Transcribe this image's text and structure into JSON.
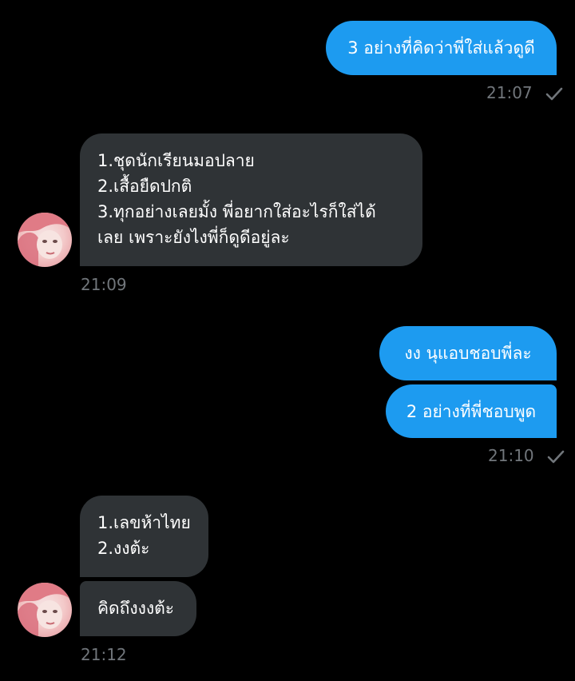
{
  "messages": [
    {
      "direction": "outgoing",
      "text": "3 อย่างที่คิดว่าพี่ใส่แล้วดูดี"
    },
    {
      "direction": "incoming",
      "lines": [
        "1.ชุดนักเรียนมอปลาย",
        "2.เสื้อยืดปกติ",
        "3.ทุกอย่างเลยมั้ง พี่อยากใส่อะไรก็ใส่ได้",
        "เลย เพราะยังไงพี่ก็ดูดีอยู่ละ"
      ]
    },
    {
      "direction": "outgoing",
      "text": "งง นุแอบชอบพี่ละ"
    },
    {
      "direction": "outgoing",
      "text": "2 อย่างที่พี่ชอบพูด"
    },
    {
      "direction": "incoming",
      "lines": [
        "1.เลขห้าไทย",
        "2.งงต้ะ"
      ]
    },
    {
      "direction": "incoming",
      "text": "คิดถึงงงต้ะ"
    }
  ],
  "timestamps": {
    "t1": "21:07",
    "t2": "21:09",
    "t3": "21:10",
    "t4": "21:12"
  },
  "colors": {
    "background": "#000000",
    "outgoing_bubble": "#1d9bf0",
    "incoming_bubble": "#2f3336",
    "timestamp": "#71767b"
  },
  "icons": {
    "read_receipt": "checkmark-icon",
    "avatar": "avatar"
  }
}
